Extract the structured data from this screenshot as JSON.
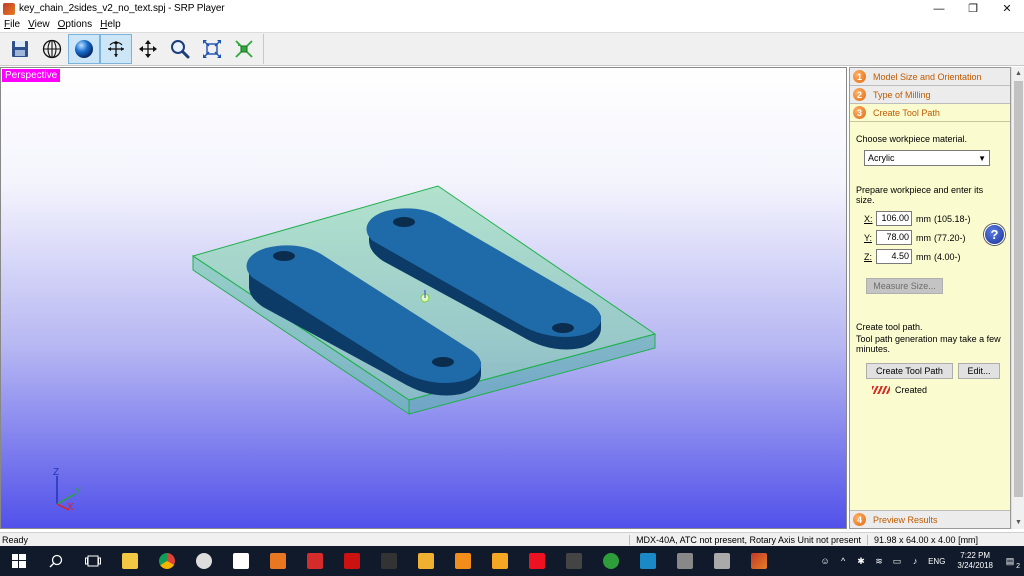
{
  "window": {
    "title": "key_chain_2sides_v2_no_text.spj - SRP Player",
    "minimize_glyph": "—",
    "restore_glyph": "❐",
    "close_glyph": "✕"
  },
  "menu": [
    "File",
    "View",
    "Options",
    "Help"
  ],
  "toolbar": {
    "buttons": [
      {
        "name": "save-icon",
        "active": false
      },
      {
        "name": "wireframe-globe-icon",
        "active": false
      },
      {
        "name": "shaded-sphere-icon",
        "active": true
      },
      {
        "name": "rotate-icon",
        "active": true
      },
      {
        "name": "pan-icon",
        "active": false
      },
      {
        "name": "zoom-icon",
        "active": false
      },
      {
        "name": "fit-view-icon",
        "active": false
      },
      {
        "name": "zoom-extents-icon",
        "active": false
      }
    ]
  },
  "viewport": {
    "label": "Perspective",
    "axes": {
      "z": "Z",
      "y": "Y",
      "x": "X"
    }
  },
  "panel": {
    "steps": [
      {
        "num": "1",
        "label": "Model Size and Orientation"
      },
      {
        "num": "2",
        "label": "Type of Milling"
      },
      {
        "num": "3",
        "label": "Create Tool Path"
      },
      {
        "num": "4",
        "label": "Preview Results"
      }
    ],
    "material_prompt": "Choose workpiece material.",
    "material_value": "Acrylic",
    "size_prompt": "Prepare workpiece and enter its size.",
    "dims": [
      {
        "axis": "X:",
        "value": "106.00",
        "unit": "mm",
        "ref": "(105.18-)"
      },
      {
        "axis": "Y:",
        "value": "78.00",
        "unit": "mm",
        "ref": "(77.20-)"
      },
      {
        "axis": "Z:",
        "value": "4.50",
        "unit": "mm",
        "ref": "(4.00-)"
      }
    ],
    "help_label": "?",
    "measure_button": "Measure Size...",
    "toolpath_title": "Create tool path.",
    "toolpath_note": "Tool path generation may take a few minutes.",
    "create_button": "Create Tool Path",
    "edit_button": "Edit...",
    "status": "Created"
  },
  "statusbar": {
    "left": "Ready",
    "machine": "MDX-40A, ATC not present, Rotary Axis Unit not present",
    "size": "91.98 x  64.00 x   4.00 [mm]"
  },
  "taskbar": {
    "lang": "ENG",
    "time": "7:22 PM",
    "date": "3/24/2018",
    "notifications": "2"
  },
  "colors": {
    "accent_orange": "#e06a10",
    "panel_bg": "#fbfbd0",
    "highlight_magenta": "#ff00ff"
  }
}
